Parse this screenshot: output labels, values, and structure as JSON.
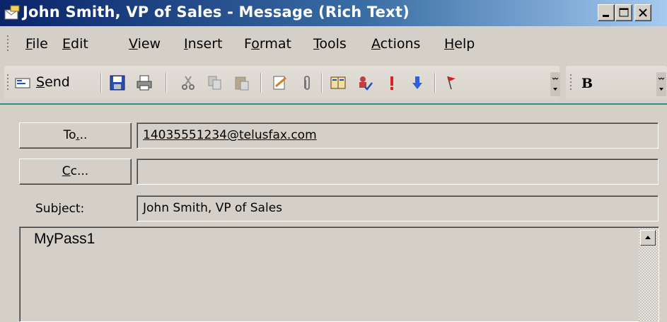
{
  "window": {
    "title": "John Smith, VP of Sales - Message (Rich Text)",
    "title_icon": "envelope-message-icon",
    "controls": [
      "minimize-icon",
      "maximize-icon",
      "close-icon"
    ]
  },
  "menubar": {
    "items": [
      {
        "pre": "",
        "u": "F",
        "post": "ile"
      },
      {
        "pre": "",
        "u": "E",
        "post": "dit"
      },
      {
        "pre": "",
        "u": "V",
        "post": "iew"
      },
      {
        "pre": "",
        "u": "I",
        "post": "nsert"
      },
      {
        "pre": "F",
        "u": "o",
        "post": "rmat"
      },
      {
        "pre": "",
        "u": "T",
        "post": "ools"
      },
      {
        "pre": "",
        "u": "A",
        "post": "ctions"
      },
      {
        "pre": "",
        "u": "H",
        "post": "elp"
      }
    ]
  },
  "toolbar": {
    "send_pre": "",
    "send_u": "S",
    "send_post": "end",
    "icons": [
      "send-icon",
      "save-icon",
      "print-icon",
      "cut-icon",
      "copy-icon",
      "paste-icon",
      "insert-file-icon",
      "attachment-icon",
      "address-book-icon",
      "check-names-icon",
      "importance-high-icon",
      "importance-low-icon",
      "flag-icon"
    ],
    "format_bold": "B"
  },
  "header": {
    "to_button": {
      "pre": "To",
      "u": ".",
      "post": ".."
    },
    "to_value": "14035551234@telusfax.com",
    "cc_button": {
      "pre": "",
      "u": "C",
      "post": "c..."
    },
    "cc_value": "",
    "subject_label": "Subject:",
    "subject_value": "John Smith, VP of Sales"
  },
  "body": {
    "text": "MyPass1"
  },
  "colors": {
    "titlebar_start": "#0a246a",
    "titlebar_end": "#a6caf0",
    "chrome": "#d4d0c8",
    "accent_line": "#2f8f8a"
  }
}
